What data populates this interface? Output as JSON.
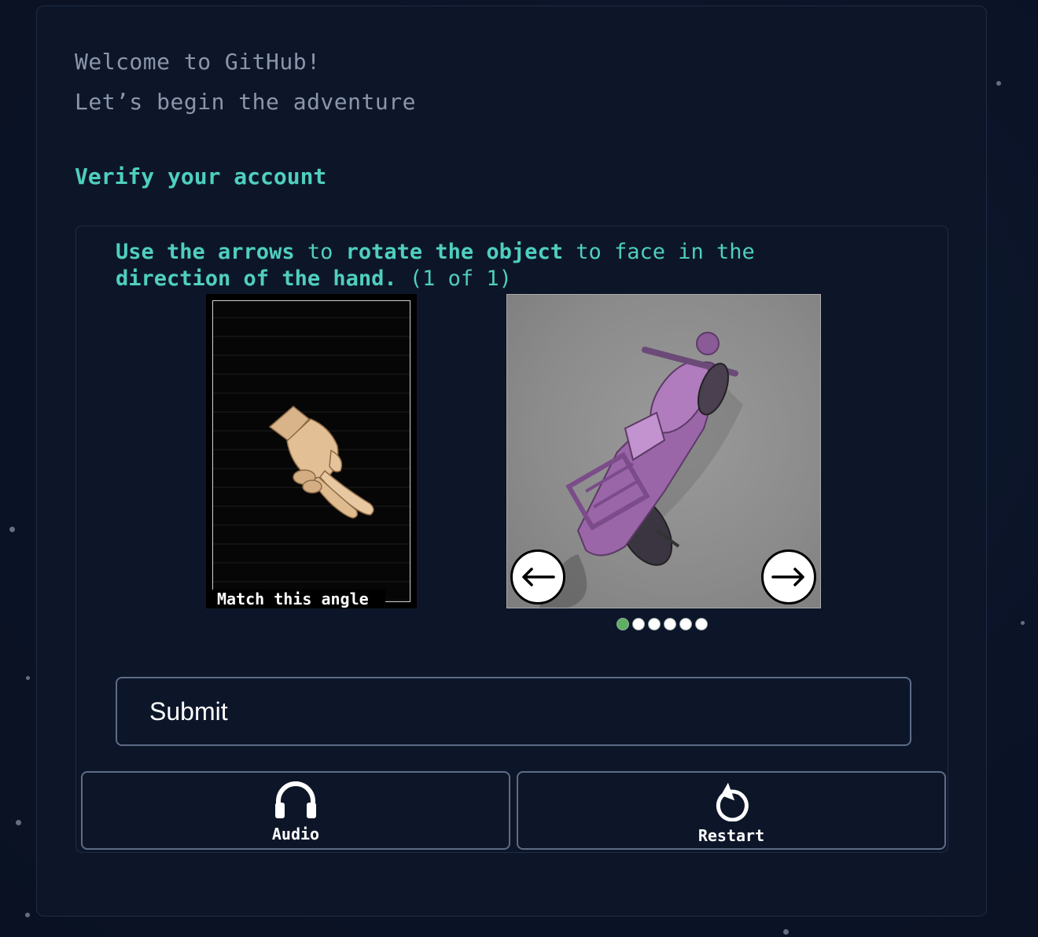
{
  "header": {
    "welcome": "Welcome to GitHub!",
    "subtitle": "Let’s begin the adventure"
  },
  "verify": {
    "title": "Verify your account"
  },
  "challenge": {
    "instruction_parts": [
      {
        "text": "Use the arrows",
        "bold": true
      },
      {
        "text": " to ",
        "bold": false
      },
      {
        "text": "rotate the object",
        "bold": true
      },
      {
        "text": " to face in the ",
        "bold": false
      },
      {
        "text": "direction of the hand.",
        "bold": true
      },
      {
        "text": " (1 of 1)",
        "bold": false
      }
    ],
    "reference_label": "Match this angle",
    "progress": {
      "total": 6,
      "current": 1
    },
    "colors": {
      "accent": "#4fcfbf",
      "active_dot": "#5db05f"
    }
  },
  "actions": {
    "submit_label": "Submit",
    "audio_label": "Audio",
    "restart_label": "Restart"
  }
}
